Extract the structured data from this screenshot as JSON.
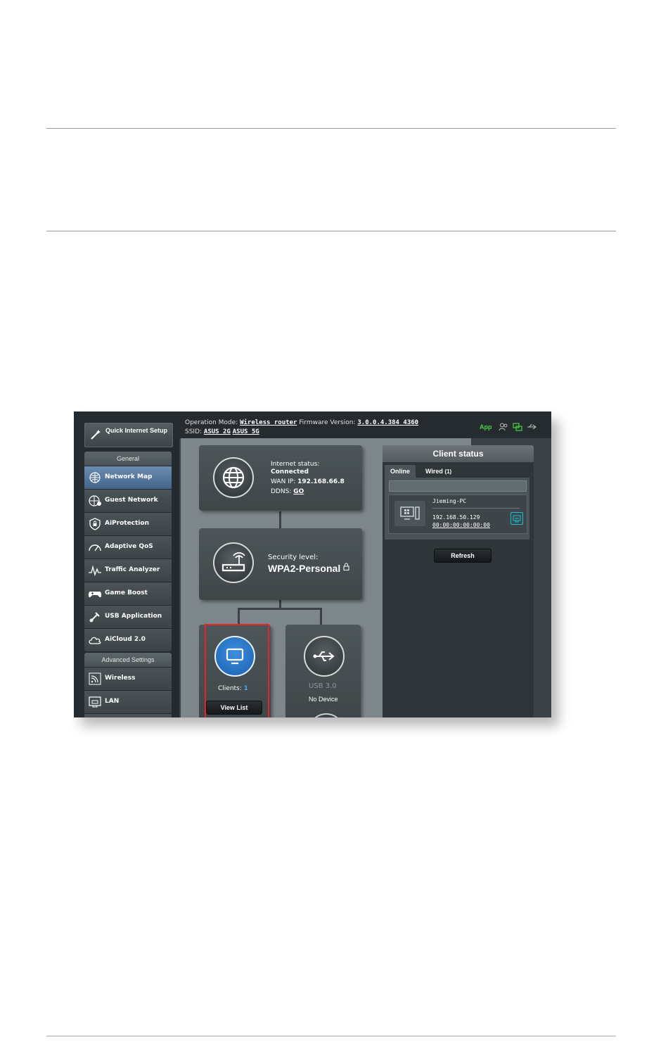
{
  "topbar": {
    "op_mode_label": "Operation Mode:",
    "op_mode_value": "Wireless router",
    "fw_label": "Firmware Version:",
    "fw_value": "3.0.0.4.384_4360",
    "ssid_label": "SSID:",
    "ssid_2g": "ASUS_2G",
    "ssid_5g": "ASUS_5G",
    "app_label": "App"
  },
  "sidebar": {
    "qis_label": "Quick Internet Setup",
    "general_header": "General",
    "general_items": [
      {
        "label": "Network Map",
        "icon": "network-map-icon"
      },
      {
        "label": "Guest Network",
        "icon": "guest-network-icon"
      },
      {
        "label": "AiProtection",
        "icon": "shield-icon"
      },
      {
        "label": "Adaptive QoS",
        "icon": "speedometer-icon"
      },
      {
        "label": "Traffic Analyzer",
        "icon": "traffic-analyzer-icon"
      },
      {
        "label": "Game Boost",
        "icon": "gamepad-icon"
      },
      {
        "label": "USB Application",
        "icon": "usb-icon"
      },
      {
        "label": "AiCloud 2.0",
        "icon": "cloud-icon"
      }
    ],
    "advanced_header": "Advanced Settings",
    "advanced_items": [
      {
        "label": "Wireless",
        "icon": "wireless-icon"
      },
      {
        "label": "LAN",
        "icon": "lan-icon"
      }
    ]
  },
  "internet": {
    "status_label": "Internet status:",
    "status_value": "Connected",
    "wan_label": "WAN IP:",
    "wan_value": "192.168.66.8",
    "ddns_label": "DDNS:",
    "ddns_value": "GO"
  },
  "security": {
    "label": "Security level:",
    "value": "WPA2-Personal"
  },
  "clients": {
    "label": "Clients:",
    "count": "1",
    "button": "View List"
  },
  "usb": {
    "label": "USB 3.0",
    "status": "No Device"
  },
  "client_status": {
    "title": "Client status",
    "tab_online": "Online",
    "tab_wired": "Wired",
    "wired_count": "(1)",
    "client": {
      "name": "Jieming-PC",
      "ip": "192.168.50.129",
      "mac": "00:00:00:00:00:00"
    },
    "refresh": "Refresh"
  },
  "colors": {
    "highlight": "#e0262a",
    "app_green": "#46d246",
    "active_menu": "#5a7ca2"
  }
}
